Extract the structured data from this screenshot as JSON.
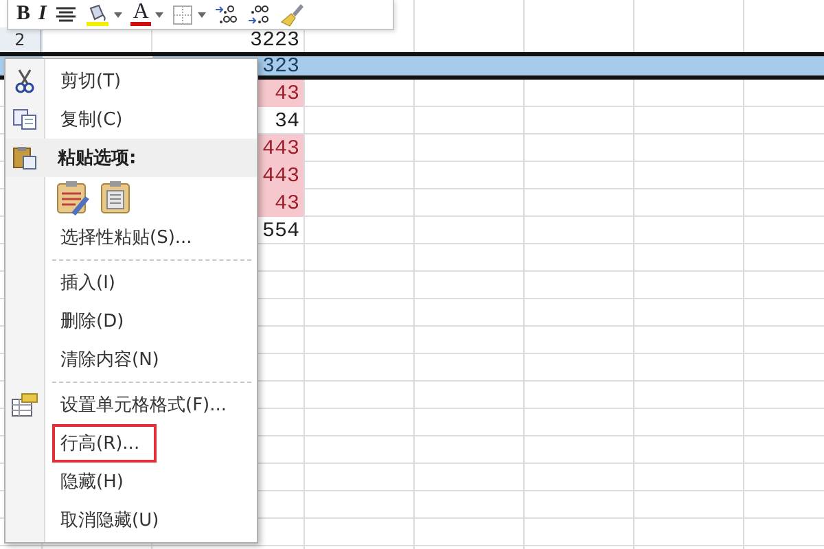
{
  "toolbar": {
    "buttons": [
      {
        "kind": "bold",
        "label": "B"
      },
      {
        "kind": "italic",
        "label": "I"
      },
      {
        "kind": "center"
      },
      {
        "kind": "fill",
        "dropdown": true
      },
      {
        "kind": "fontcolor",
        "label": "A",
        "dropdown": true
      },
      {
        "kind": "border",
        "dropdown": true
      },
      {
        "kind": "increase-decimal"
      },
      {
        "kind": "decrease-decimal"
      },
      {
        "kind": "painter"
      }
    ]
  },
  "sheet": {
    "rows": [
      {
        "header": "2",
        "value": "3223",
        "selected": false,
        "flagged": false
      },
      {
        "value": "323",
        "selected": true,
        "flagged": false
      },
      {
        "value": "43",
        "selected": false,
        "flagged": true
      },
      {
        "value": "34",
        "selected": false,
        "flagged": false
      },
      {
        "value": "443",
        "selected": false,
        "flagged": true
      },
      {
        "value": "443",
        "selected": false,
        "flagged": true
      },
      {
        "value": "43",
        "selected": false,
        "flagged": true
      },
      {
        "value": "554",
        "selected": false,
        "flagged": false
      }
    ]
  },
  "context_menu": {
    "items": [
      {
        "kind": "item",
        "label": "剪切(T)",
        "marked": false
      },
      {
        "kind": "item",
        "label": "复制(C)",
        "marked": false
      },
      {
        "kind": "heading",
        "label": "粘贴选项:"
      },
      {
        "kind": "paste_options"
      },
      {
        "kind": "item",
        "label": "选择性粘贴(S)...",
        "marked": false
      },
      {
        "kind": "separator"
      },
      {
        "kind": "item",
        "label": "插入(I)",
        "marked": false
      },
      {
        "kind": "item",
        "label": "删除(D)",
        "marked": false
      },
      {
        "kind": "item",
        "label": "清除内容(N)",
        "marked": false
      },
      {
        "kind": "separator"
      },
      {
        "kind": "item",
        "label": "设置单元格格式(F)...",
        "marked": false
      },
      {
        "kind": "item",
        "label": "行高(R)...",
        "marked": true
      },
      {
        "kind": "item",
        "label": "隐藏(H)",
        "marked": false
      },
      {
        "kind": "item",
        "label": "取消隐藏(U)",
        "marked": false
      }
    ]
  }
}
